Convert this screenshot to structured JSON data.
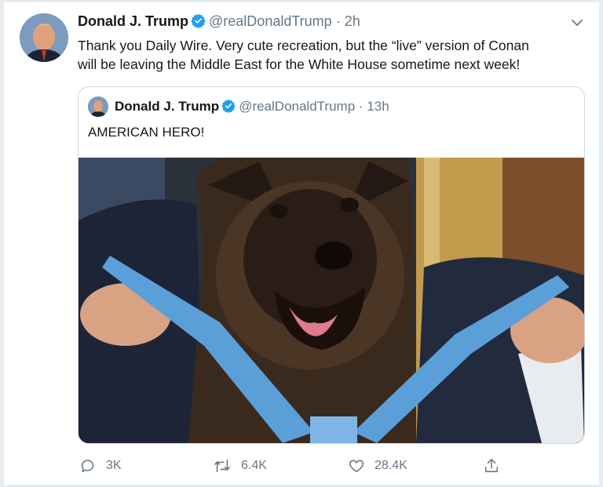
{
  "tweet": {
    "author_name": "Donald J. Trump",
    "handle": "@realDonaldTrump",
    "separator": "·",
    "time": "2h",
    "text_line1": "Thank you Daily Wire. Very cute recreation, but the “live” version of Conan",
    "text_line2": "will be leaving the Middle East for the White House sometime next week!"
  },
  "quoted": {
    "author_name": "Donald J. Trump",
    "handle": "@realDonaldTrump",
    "separator": "·",
    "time": "13h",
    "text": "AMERICAN HERO!"
  },
  "actions": {
    "reply_count": "3K",
    "retweet_count": "6.4K",
    "like_count": "28.4K"
  },
  "icons": {
    "verified": "verified-badge-icon",
    "more": "chevron-down-icon",
    "reply": "reply-icon",
    "retweet": "retweet-icon",
    "like": "heart-icon",
    "share": "share-icon"
  },
  "colors": {
    "verified": "#1da1f2",
    "muted": "#657786",
    "border": "#ccd6dd",
    "medal_ribbon": "#5b9fd8"
  }
}
